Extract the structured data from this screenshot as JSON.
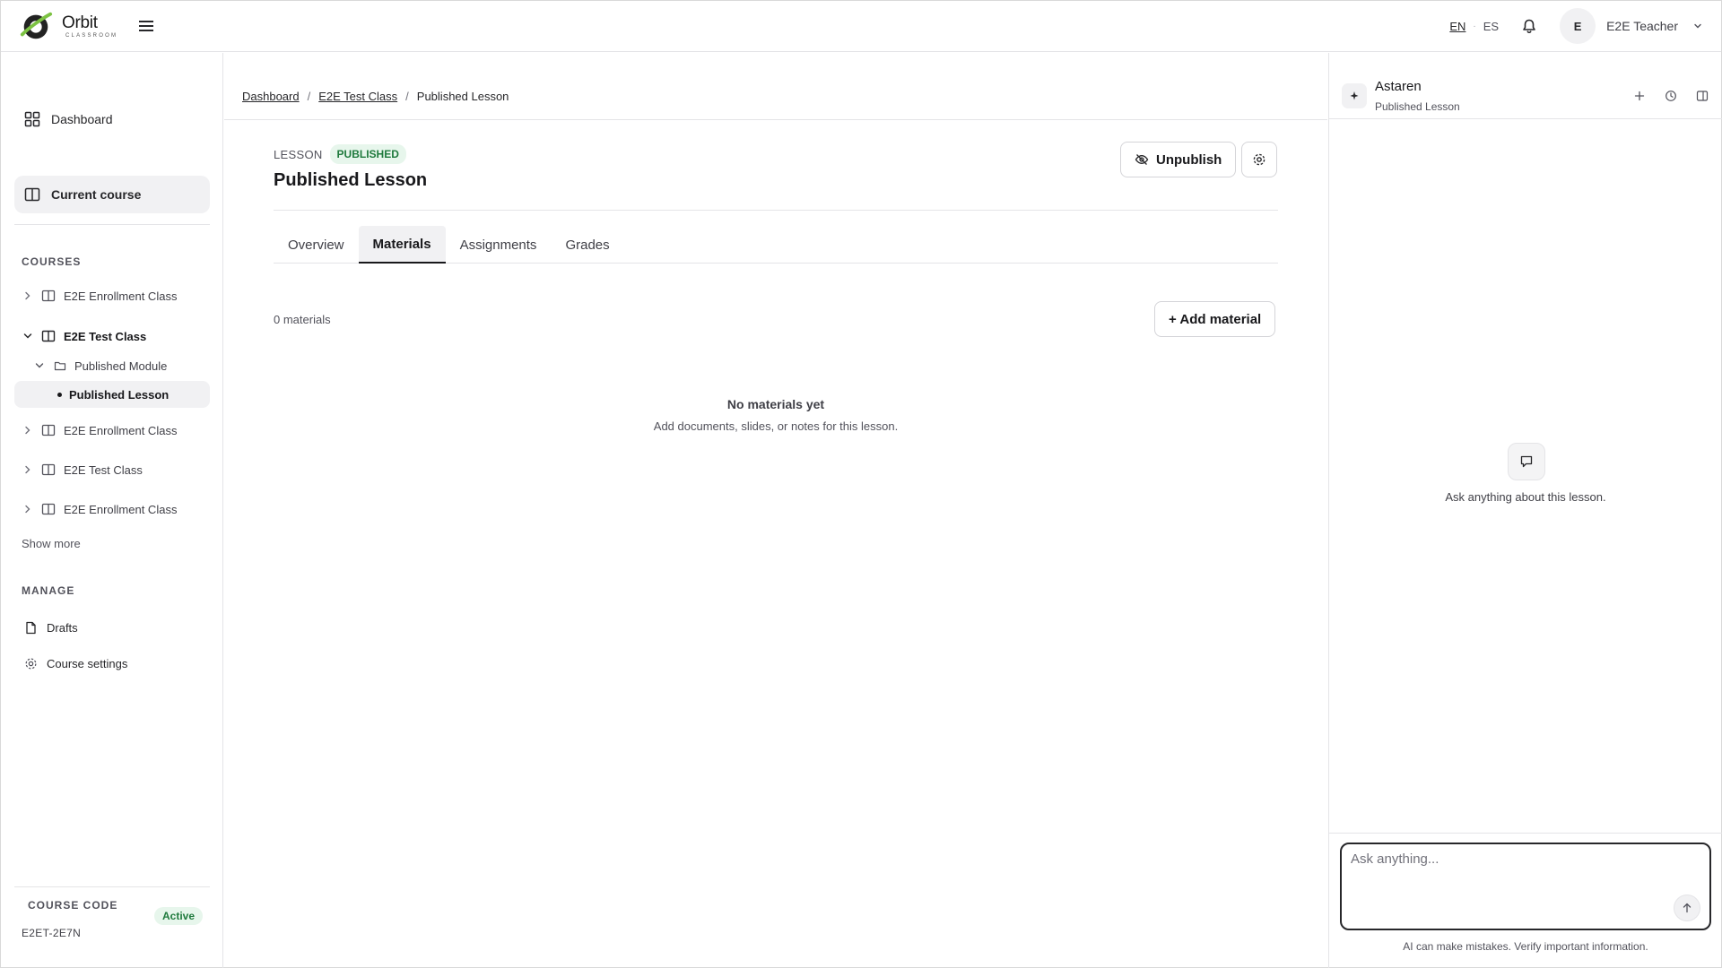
{
  "brand": {
    "name": "Orbit",
    "sub": "CLASSROOM"
  },
  "topbar": {
    "lang_en": "EN",
    "lang_sep": "·",
    "lang_es": "ES",
    "user_initial": "E",
    "user_name": "E2E Teacher"
  },
  "sidebar": {
    "dashboard": "Dashboard",
    "current_course": "Current course",
    "courses_label": "COURSES",
    "courses": [
      {
        "label": "E2E Enrollment Class"
      },
      {
        "label": "E2E Test Class"
      },
      {
        "label": "Published Module"
      },
      {
        "label": "Published Lesson"
      },
      {
        "label": "E2E Enrollment Class"
      },
      {
        "label": "E2E Test Class"
      },
      {
        "label": "E2E Enrollment Class"
      }
    ],
    "show_more": "Show more",
    "manage_label": "MANAGE",
    "drafts": "Drafts",
    "course_settings": "Course settings",
    "course_code_label": "COURSE CODE",
    "course_code": "E2ET-2E7N",
    "status": "Active"
  },
  "main": {
    "breadcrumb": [
      "Dashboard",
      "E2E Test Class",
      "Published Lesson"
    ],
    "breadcrumb_sep": "/",
    "kicker": "LESSON",
    "badge": "PUBLISHED",
    "title": "Published Lesson",
    "unpublish": "Unpublish",
    "tabs": [
      "Overview",
      "Materials",
      "Assignments",
      "Grades"
    ],
    "active_tab": "Materials",
    "materials_count": "0 materials",
    "add_material": "+ Add material",
    "empty_title": "No materials yet",
    "empty_sub": "Add documents, slides, or notes for this lesson."
  },
  "panel": {
    "title": "Astaren",
    "subtitle": "Published Lesson",
    "empty_text": "Ask anything about this lesson.",
    "placeholder": "Ask anything...",
    "disclaimer": "AI can make mistakes. Verify important information."
  },
  "colors": {
    "accent_green": "#1f7a3d",
    "badge_bg": "#e7f6ec",
    "logo_green": "#7cc242"
  }
}
